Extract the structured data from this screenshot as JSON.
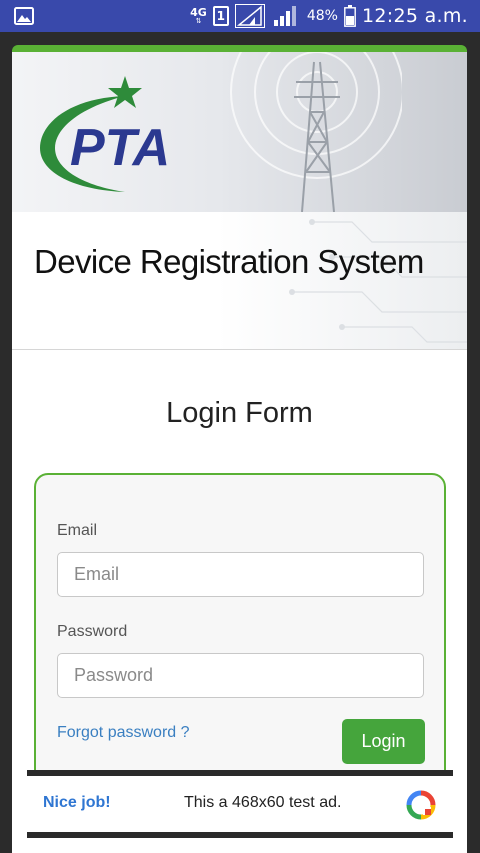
{
  "status_bar": {
    "network": "4G",
    "sim": "1",
    "battery": "48%",
    "time": "12:25 a.m.",
    "icons": [
      "gallery-icon",
      "signal-icon",
      "battery-icon"
    ]
  },
  "banner": {
    "logo_text": "PTA",
    "colors": {
      "logo_green": "#2e8b3a",
      "logo_blue": "#2b3990",
      "accent": "#5ab135"
    }
  },
  "title": "Device Registration System",
  "form": {
    "heading": "Login Form",
    "email_label": "Email",
    "email_placeholder": "Email",
    "password_label": "Password",
    "password_placeholder": "Password",
    "forgot_link": "Forgot password ?",
    "login_button": "Login",
    "button_color": "#45a53c"
  },
  "ad": {
    "left_text": "Nice job!",
    "center_text": "This a 468x60 test ad.",
    "icon": "ads-logo-icon"
  }
}
